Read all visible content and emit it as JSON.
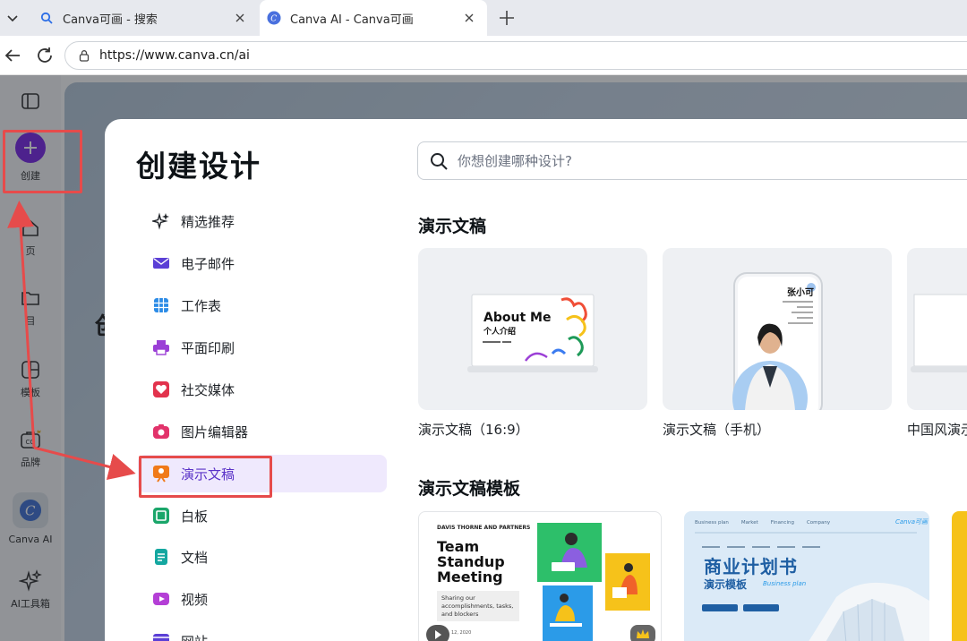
{
  "browser": {
    "tabs": [
      {
        "title": "Canva可画 - 搜索",
        "active": false,
        "icon": "search-icon"
      },
      {
        "title": "Canva AI - Canva可画",
        "active": true,
        "icon": "canva-logo-icon"
      }
    ],
    "url": "https://www.canva.cn/ai"
  },
  "rail": {
    "create": "创建",
    "home": "页",
    "projects": "目",
    "templates": "模板",
    "brand": "品牌",
    "canva_ai": "Canva AI",
    "ai_toolbox": "AI工具箱"
  },
  "background": {
    "partial_heading": "创"
  },
  "modal": {
    "title": "创建设计",
    "search_placeholder": "你想创建哪种设计?",
    "categories": [
      {
        "label": "精选推荐",
        "icon": "sparkle-icon",
        "color": "#1f2328"
      },
      {
        "label": "电子邮件",
        "icon": "envelope-icon",
        "color": "#5b3fd6"
      },
      {
        "label": "工作表",
        "icon": "spreadsheet-icon",
        "color": "#2b8be6"
      },
      {
        "label": "平面印刷",
        "icon": "printer-icon",
        "color": "#9b3fd6"
      },
      {
        "label": "社交媒体",
        "icon": "heart-icon",
        "color": "#e2334d"
      },
      {
        "label": "图片编辑器",
        "icon": "camera-icon",
        "color": "#e2336b"
      },
      {
        "label": "演示文稿",
        "icon": "presentation-icon",
        "color": "#f07a1a",
        "active": true
      },
      {
        "label": "白板",
        "icon": "whiteboard-icon",
        "color": "#1aa66a"
      },
      {
        "label": "文档",
        "icon": "document-icon",
        "color": "#14a7a0"
      },
      {
        "label": "视频",
        "icon": "video-icon",
        "color": "#b43fd6"
      },
      {
        "label": "网站",
        "icon": "website-icon",
        "color": "#5b3fd6"
      }
    ],
    "presentations_title": "演示文稿",
    "presentation_cards": [
      {
        "label": "演示文稿（16:9）",
        "preview_title": "About Me",
        "preview_subtitle": "个人介绍"
      },
      {
        "label": "演示文稿（手机）",
        "preview_name": "张小可"
      },
      {
        "label": "中国风演示"
      }
    ],
    "templates_title": "演示文稿模板",
    "template_cards": [
      {
        "company": "DAVIS THORNE AND PARTNERS",
        "title": "Team Standup Meeting",
        "subtitle": "Sharing our accomplishments, tasks, and blockers",
        "date": "12, 2020"
      },
      {
        "nav": [
          "Business plan",
          "Market",
          "Financing",
          "Company"
        ],
        "brand": "Canva可画",
        "title": "商业计划书",
        "subtitle": "演示模板",
        "tag": "Business plan"
      }
    ]
  },
  "colors": {
    "accent": "#7d2ae8",
    "active_bg": "#efe9fd",
    "annotation": "#e64b4b"
  }
}
